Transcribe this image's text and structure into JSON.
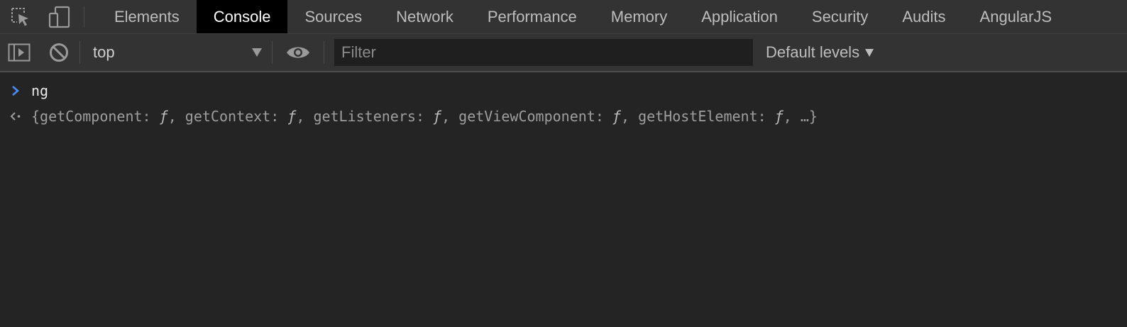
{
  "tabs": [
    {
      "label": "Elements",
      "active": false
    },
    {
      "label": "Console",
      "active": true
    },
    {
      "label": "Sources",
      "active": false
    },
    {
      "label": "Network",
      "active": false
    },
    {
      "label": "Performance",
      "active": false
    },
    {
      "label": "Memory",
      "active": false
    },
    {
      "label": "Application",
      "active": false
    },
    {
      "label": "Security",
      "active": false
    },
    {
      "label": "Audits",
      "active": false
    },
    {
      "label": "AngularJS",
      "active": false
    }
  ],
  "toolbar": {
    "icons": {
      "inspect": "inspect-element-icon",
      "device": "device-toolbar-icon",
      "sidebar": "show-console-sidebar-icon",
      "clear": "clear-console-icon",
      "live": "live-expression-eye-icon"
    },
    "context": "top",
    "filter_placeholder": "Filter",
    "filter_value": "",
    "levels": "Default levels"
  },
  "console": {
    "input": "ng",
    "output": {
      "open": "{",
      "entries": [
        {
          "key": "getComponent",
          "value": "ƒ"
        },
        {
          "key": "getContext",
          "value": "ƒ"
        },
        {
          "key": "getListeners",
          "value": "ƒ"
        },
        {
          "key": "getViewComponent",
          "value": "ƒ"
        },
        {
          "key": "getHostElement",
          "value": "ƒ"
        }
      ],
      "ellipsis": "…",
      "close": "}"
    }
  },
  "colors": {
    "background": "#242424",
    "toolbar": "#333333",
    "active_tab": "#000000",
    "prompt_accent": "#4a8df8"
  }
}
